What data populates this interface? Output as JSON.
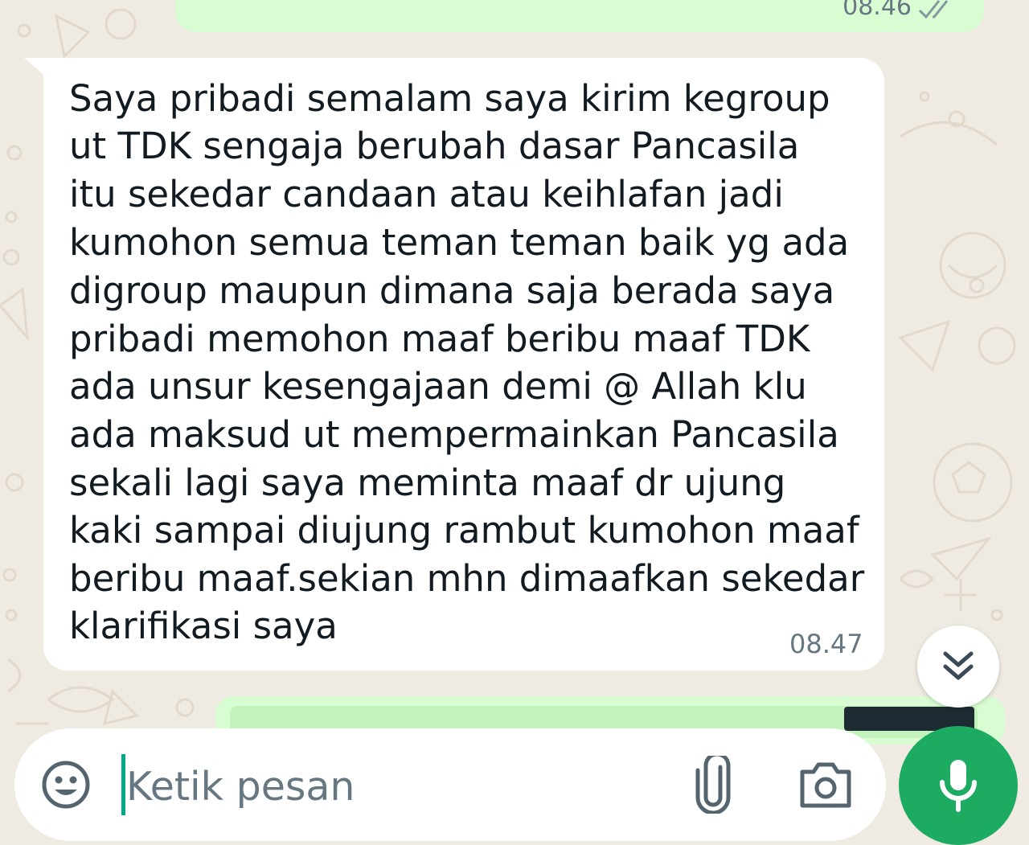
{
  "chat": {
    "outgoing_top": {
      "time": "08.46",
      "status": "read"
    },
    "incoming": {
      "lines": [
        "Saya pribadi semalam saya kirim kegroup",
        "ut TDK sengaja berubah dasar Pancasila",
        "itu sekedar candaan atau keihlafan jadi",
        "kumohon semua teman teman baik yg ada",
        "digroup maupun dimana saja berada saya",
        "pribadi memohon maaf beribu maaf TDK",
        "ada unsur kesengajaan demi @ Allah klu",
        "ada maksud ut mempermainkan Pancasila",
        "sekali lagi saya meminta maaf dr ujung",
        "kaki sampai diujung rambut kumohon maaf",
        "beribu maaf.sekian mhn dimaafkan sekedar",
        "klarifikasi saya"
      ],
      "time": "08.47"
    }
  },
  "composer": {
    "placeholder": "Ketik pesan"
  },
  "icons": {
    "emoji": "emoji-icon",
    "attach": "paperclip-icon",
    "camera": "camera-icon",
    "mic": "microphone-icon",
    "scroll": "double-chevron-down-icon"
  },
  "colors": {
    "background": "#efeae2",
    "outgoing_bubble": "#d9fdd3",
    "incoming_bubble": "#ffffff",
    "accent": "#1daa61",
    "caret": "#00a884",
    "timestamp": "#667781"
  }
}
